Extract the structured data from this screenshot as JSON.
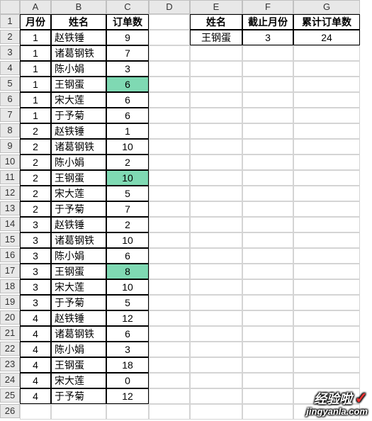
{
  "columns": [
    "A",
    "B",
    "C",
    "D",
    "E",
    "F",
    "G"
  ],
  "row_count": 26,
  "table1": {
    "headers": {
      "A": "月份",
      "B": "姓名",
      "C": "订单数"
    },
    "rows": [
      {
        "A": "1",
        "B": "赵铁锤",
        "C": "9",
        "hl": false
      },
      {
        "A": "1",
        "B": "诸葛钢铁",
        "C": "7",
        "hl": false
      },
      {
        "A": "1",
        "B": "陈小娟",
        "C": "3",
        "hl": false
      },
      {
        "A": "1",
        "B": "王钢蛋",
        "C": "6",
        "hl": true
      },
      {
        "A": "1",
        "B": "宋大莲",
        "C": "6",
        "hl": false
      },
      {
        "A": "1",
        "B": "于予菊",
        "C": "6",
        "hl": false
      },
      {
        "A": "2",
        "B": "赵铁锤",
        "C": "1",
        "hl": false
      },
      {
        "A": "2",
        "B": "诸葛钢铁",
        "C": "10",
        "hl": false
      },
      {
        "A": "2",
        "B": "陈小娟",
        "C": "2",
        "hl": false
      },
      {
        "A": "2",
        "B": "王钢蛋",
        "C": "10",
        "hl": true
      },
      {
        "A": "2",
        "B": "宋大莲",
        "C": "5",
        "hl": false
      },
      {
        "A": "2",
        "B": "于予菊",
        "C": "7",
        "hl": false
      },
      {
        "A": "3",
        "B": "赵铁锤",
        "C": "2",
        "hl": false
      },
      {
        "A": "3",
        "B": "诸葛钢铁",
        "C": "10",
        "hl": false
      },
      {
        "A": "3",
        "B": "陈小娟",
        "C": "6",
        "hl": false
      },
      {
        "A": "3",
        "B": "王钢蛋",
        "C": "8",
        "hl": true
      },
      {
        "A": "3",
        "B": "宋大莲",
        "C": "10",
        "hl": false
      },
      {
        "A": "3",
        "B": "于予菊",
        "C": "5",
        "hl": false
      },
      {
        "A": "4",
        "B": "赵铁锤",
        "C": "12",
        "hl": false
      },
      {
        "A": "4",
        "B": "诸葛钢铁",
        "C": "6",
        "hl": false
      },
      {
        "A": "4",
        "B": "陈小娟",
        "C": "3",
        "hl": false
      },
      {
        "A": "4",
        "B": "王钢蛋",
        "C": "18",
        "hl": false
      },
      {
        "A": "4",
        "B": "宋大莲",
        "C": "0",
        "hl": false
      },
      {
        "A": "4",
        "B": "于予菊",
        "C": "12",
        "hl": false
      }
    ]
  },
  "table2": {
    "headers": {
      "E": "姓名",
      "F": "截止月份",
      "G": "累计订单数"
    },
    "row": {
      "E": "王钢蛋",
      "F": "3",
      "G": "24"
    }
  },
  "watermark": {
    "line1": "经验啦",
    "line2": "jingyanla.com"
  }
}
